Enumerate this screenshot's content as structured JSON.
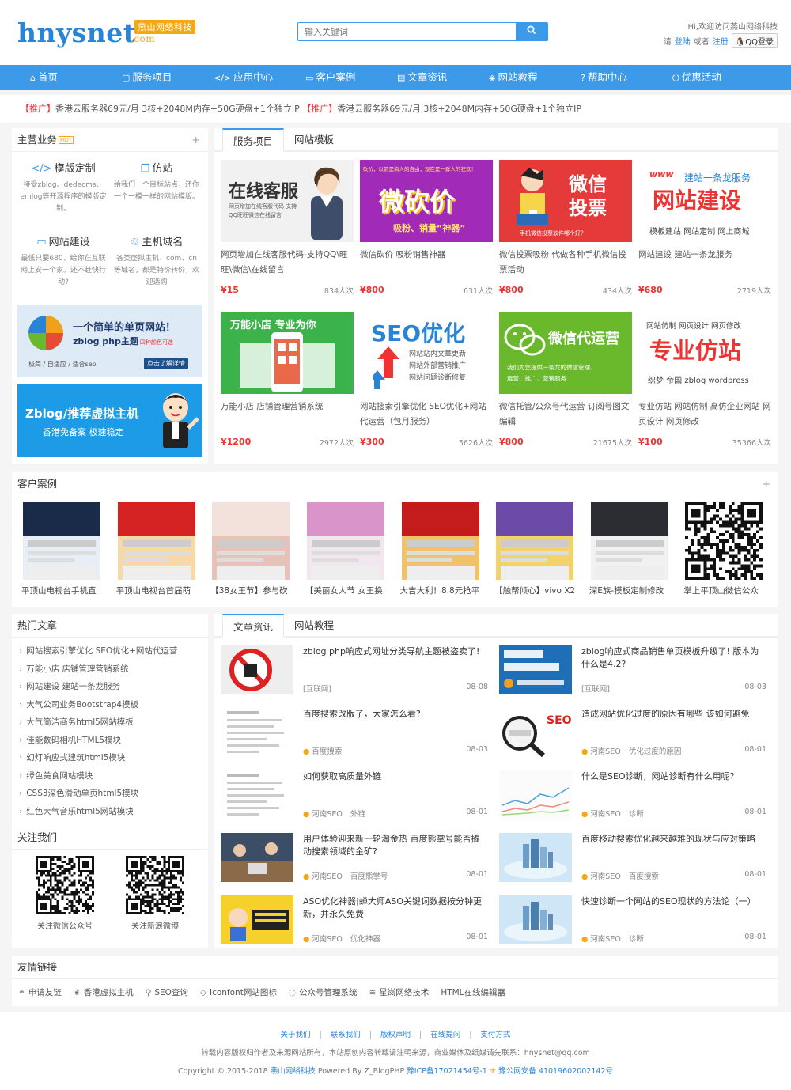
{
  "header": {
    "logo_text": "hnysnet",
    "logo_badge": "燕山网络科技",
    "logo_com": ".com",
    "search_placeholder": "输入关键词",
    "welcome": "Hi,欢迎访问燕山网络科技",
    "login_please": "请",
    "login_link": "登陆",
    "or": "或者",
    "register_link": "注册",
    "qq_login": "QQ登录"
  },
  "nav": [
    {
      "icon": "home-icon",
      "glyph": "⌂",
      "label": "首页"
    },
    {
      "icon": "service-icon",
      "glyph": "▢",
      "label": "服务项目"
    },
    {
      "icon": "code-icon",
      "glyph": "</>",
      "label": "应用中心"
    },
    {
      "icon": "case-icon",
      "glyph": "▭",
      "label": "客户案例"
    },
    {
      "icon": "article-icon",
      "glyph": "▤",
      "label": "文章资讯"
    },
    {
      "icon": "tutorial-icon",
      "glyph": "◈",
      "label": "网站教程"
    },
    {
      "icon": "help-icon",
      "glyph": "?",
      "label": "帮助中心"
    },
    {
      "icon": "power-icon",
      "glyph": "⏻",
      "label": "优惠活动"
    }
  ],
  "promo": {
    "tag": "【推广】",
    "text": "香港云服务器69元/月 3核+2048M内存+50G硬盘+1个独立IP"
  },
  "business": {
    "title": "主营业务",
    "hot": "HOT",
    "plus": "+",
    "items": [
      {
        "icon": "code-icon",
        "glyph": "</>",
        "title": "模版定制",
        "desc": "接受zblog、dedecms、emlog等开源程序的模版定制。"
      },
      {
        "icon": "copy-icon",
        "glyph": "❐",
        "title": "仿站",
        "desc": "给我们一个目标站点，还你一个一模一样的网站模版。"
      },
      {
        "icon": "monitor-icon",
        "glyph": "▭",
        "title": "网站建设",
        "desc": "最低只要680，给你在互联网上安一个家。还不赶快行动?"
      },
      {
        "icon": "domain-icon",
        "glyph": "♲",
        "title": "主机域名",
        "desc": "各类虚拟主机、com、cn等域名，都是特价转价，欢迎选购"
      }
    ],
    "ad1_title": "一个简单的单页网站！",
    "ad1_sub": "zblog php主题",
    "ad1_tag": "四种颜色可选",
    "ad1_foot": "极简 / 自适应 / 适合seo",
    "ad1_btn": "点击了解详情",
    "ad2_title": "Zblog/推荐虚拟主机",
    "ad2_sub": "香港免备案 极速稳定"
  },
  "services": {
    "tabs": [
      "服务项目",
      "网站模板"
    ],
    "items": [
      {
        "img": "客服",
        "title": "网页增加在线客服代码-支持QQ\\旺旺\\微信\\在线留言",
        "price": "¥15",
        "count": "834人次",
        "bg": "#f1f1f1"
      },
      {
        "img": "微砍价",
        "title": "微信砍价 吸粉销售神器",
        "price": "¥800",
        "count": "631人次",
        "bg": "#a12ab8"
      },
      {
        "img": "微信投票",
        "title": "微信投票吸粉 代做各种手机微信投票活动",
        "price": "¥800",
        "count": "434人次",
        "bg": "#e53a3a"
      },
      {
        "img": "网站建设",
        "title": "网站建设 建站一条龙服务",
        "price": "¥680",
        "count": "2719人次",
        "bg": "#ffffff"
      },
      {
        "img": "万能小店",
        "title": "万能小店 店铺管理营销系统",
        "price": "¥1200",
        "count": "2972人次",
        "bg": "#3bb34a"
      },
      {
        "img": "SEO优化",
        "title": "网站搜索引擎优化 SEO优化+网站代运营（包月服务）",
        "price": "¥300",
        "count": "5626人次",
        "bg": "#ffffff"
      },
      {
        "img": "微信代运营",
        "title": "微信托管/公众号代运营 订阅号图文编辑",
        "price": "¥800",
        "count": "21675人次",
        "bg": "#6ab82c"
      },
      {
        "img": "专业仿站",
        "title": "专业仿站 网站仿制 高仿企业网站 网页设计 网页修改",
        "price": "¥100",
        "count": "35366人次",
        "bg": "#ffffff"
      }
    ],
    "img_texts": {
      "kf_title": "在线客服",
      "kf_sub": "网页增加在线客服代码 支持QQ旺旺微信在线留言",
      "kj_top": "砍价，以前是商人的自由；现在是一群人的狂欢！",
      "kj_title": "微砍价",
      "kj_sub": "吸粉、销量“神器”",
      "tp_title": "微信投票",
      "tp_sub": "手机微信投票软件哪个好？",
      "jz_top": "建站一条龙服务",
      "jz_title": "网站建设",
      "jz_sub": "模板建站 网站定制 网上商城",
      "xd_title": "万能小店 专业为你",
      "seo_title": "SEO优化",
      "seo_l1": "网站站内文章更新",
      "seo_l2": "网站外部营销推广",
      "seo_l3": "网站问题诊断修复",
      "wx_title": "微信代运营",
      "wx_sub": "我们为您提供一条龙的微信管理、运营、推广、营销服务",
      "fz_top": "网站仿制 网页设计 网页修改",
      "fz_title": "专业仿站",
      "fz_sub": "织梦 帝国 zblog wordpress"
    }
  },
  "cases": {
    "title": "客户案例",
    "plus": "+",
    "items": [
      {
        "title": "平顶山电视台手机直",
        "c1": "#1a2b4a",
        "c2": "#e8eef6"
      },
      {
        "title": "平顶山电视台首届萌",
        "c1": "#d42222",
        "c2": "#f7d9a8"
      },
      {
        "title": "【38女王节】参与砍",
        "c1": "#f3e1dc",
        "c2": "#e7c2b8"
      },
      {
        "title": "【美丽女人节 女王换",
        "c1": "#d994c9",
        "c2": "#f2e6ef"
      },
      {
        "title": "大吉大利！8.8元抢平",
        "c1": "#c41c1c",
        "c2": "#f0c36b"
      },
      {
        "title": "【触帮倾心】vivo X2",
        "c1": "#6b4aa8",
        "c2": "#f2d26a"
      },
      {
        "title": "深E族-模板定制修改",
        "c1": "#2b2d33",
        "c2": "#f1f1f1"
      },
      {
        "title": "掌上平顶山微信公众",
        "c1": "#ffffff",
        "c2": "#000000"
      }
    ]
  },
  "hot": {
    "title": "热门文章",
    "items": [
      "网站搜索引擎优化 SEO优化+网站代运营",
      "万能小店 店铺管理营销系统",
      "网站建设 建站一条龙服务",
      "大气公司业务Bootstrap4模板",
      "大气简洁商务html5网站模板",
      "佳能数码相机HTML5模块",
      "幻灯响应式建筑html5模块",
      "绿色美食网站模块",
      "CSS3深色滑动单页html5模块",
      "红色大气音乐html5网站模块"
    ],
    "follow_title": "关注我们",
    "wechat": "关注微信公众号",
    "weibo": "关注新浪微博"
  },
  "news": {
    "tabs": [
      "文章资讯",
      "网站教程"
    ],
    "items": [
      {
        "title": "zblog php响应式网址分类导航主题被盗卖了!",
        "tag1": "[互联网]",
        "tag2": "",
        "date": "08-08",
        "img": "stop"
      },
      {
        "title": "zblog响应式商品销售单页模板升级了! 版本为什么是4.2?",
        "tag1": "[互联网]",
        "tag2": "",
        "date": "08-03",
        "img": "blue"
      },
      {
        "title": "百度搜索改版了，大家怎么看?",
        "tag1": "百度搜索",
        "tag2": "",
        "date": "08-03",
        "img": "page"
      },
      {
        "title": "造成网站优化过度的原因有哪些 该如何避免",
        "tag1": "河南SEO",
        "tag2": "优化过度的原因",
        "date": "08-01",
        "img": "seo"
      },
      {
        "title": "如何获取高质量外链",
        "tag1": "河南SEO",
        "tag2": "外链",
        "date": "08-01",
        "img": "page"
      },
      {
        "title": "什么是SEO诊断，网站诊断有什么用呢?",
        "tag1": "河南SEO",
        "tag2": "诊断",
        "date": "08-01",
        "img": "chart"
      },
      {
        "title": "用户体验迎来新一轮淘金热 百度熊掌号能否撬动搜索领域的金矿?",
        "tag1": "河南SEO",
        "tag2": "百度熊掌号",
        "date": "08-01",
        "img": "people"
      },
      {
        "title": "百度移动搜索优化越来越难的现状与应对策略",
        "tag1": "河南SEO",
        "tag2": "百度搜索",
        "date": "08-01",
        "img": "city"
      },
      {
        "title": "ASO优化神器|蝉大师ASO关键词数据按分钟更新，并永久免费",
        "tag1": "河南SEO",
        "tag2": "优化神器",
        "date": "08-01",
        "img": "yellow"
      },
      {
        "title": "快速诊断一个网站的SEO现状的方法论（一）",
        "tag1": "河南SEO",
        "tag2": "诊断",
        "date": "08-01",
        "img": "city"
      }
    ]
  },
  "links": {
    "title": "友情链接",
    "items": [
      {
        "icon": "link-icon",
        "glyph": "⚭",
        "label": "申请友链"
      },
      {
        "icon": "leaf-icon",
        "glyph": "❦",
        "label": "香港虚拟主机"
      },
      {
        "icon": "search-icon",
        "glyph": "⚲",
        "label": "SEO查询"
      },
      {
        "icon": "diamond-icon",
        "glyph": "◇",
        "label": "Iconfont网站图标"
      },
      {
        "icon": "chat-icon",
        "glyph": "◌",
        "label": "公众号管理系统"
      },
      {
        "icon": "net-icon",
        "glyph": "≋",
        "label": "星岚网络技术"
      },
      {
        "icon": "",
        "glyph": "",
        "label": "HTML在线编辑器"
      }
    ]
  },
  "footer": {
    "links": [
      "关于我们",
      "联系我们",
      "版权声明",
      "在线提问",
      "支付方式"
    ],
    "sep": "|",
    "notice": "转载内容版权归作者及来源网站所有，本站原创内容转载请注明来源，商业媒体及纸媒请先联系：hnysnet@qq.com",
    "copy_prefix": "Copyright © 2015-2018",
    "company": "燕山网络科技",
    "powered": "Powered By Z_BlogPHP",
    "icp": "豫ICP备17021454号-1",
    "police": "豫公网安备 41019602002142号"
  },
  "colors": {
    "accent": "#3d9ae8",
    "price": "#ee3333",
    "tag": "#f4a814"
  }
}
